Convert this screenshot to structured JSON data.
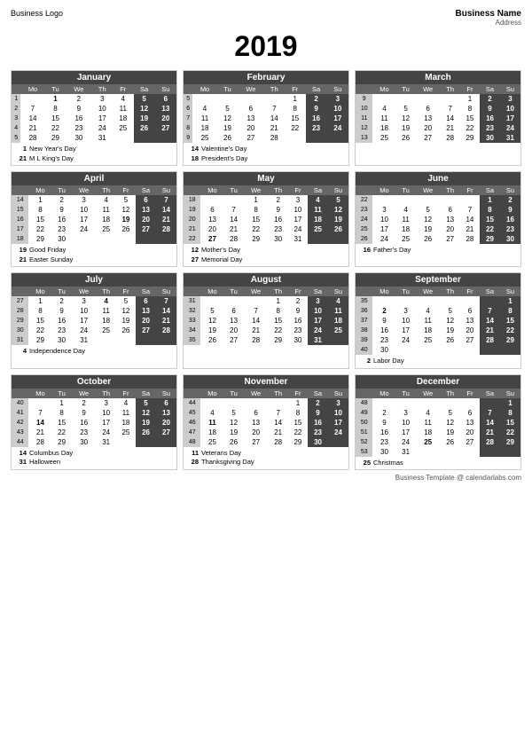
{
  "header": {
    "logo": "Business Logo",
    "name": "Business Name",
    "address": "Address"
  },
  "year": "2019",
  "footer": "Business Template @ calendarlabs.com",
  "months": [
    {
      "name": "January",
      "weeks": [
        [
          "",
          "Mo",
          "Tu",
          "We",
          "Th",
          "Fr",
          "Sa",
          "Su"
        ],
        [
          "1",
          "",
          "1",
          "2",
          "3",
          "4",
          "5",
          "6"
        ],
        [
          "2",
          "7",
          "8",
          "9",
          "10",
          "11",
          "12",
          "13"
        ],
        [
          "3",
          "14",
          "15",
          "16",
          "17",
          "18",
          "19",
          "20"
        ],
        [
          "4",
          "21",
          "22",
          "23",
          "24",
          "25",
          "26",
          "27"
        ],
        [
          "5",
          "28",
          "29",
          "30",
          "31",
          "",
          "",
          ""
        ]
      ],
      "holidays": [
        {
          "num": "1",
          "name": "New Year's Day"
        },
        {
          "num": "21",
          "name": "M L King's Day"
        }
      ]
    },
    {
      "name": "February",
      "weeks": [
        [
          "",
          "Mo",
          "Tu",
          "We",
          "Th",
          "Fr",
          "Sa",
          "Su"
        ],
        [
          "5",
          "",
          "",
          "",
          "",
          "1",
          "2",
          "3"
        ],
        [
          "6",
          "4",
          "5",
          "6",
          "7",
          "8",
          "9",
          "10"
        ],
        [
          "7",
          "11",
          "12",
          "13",
          "14",
          "15",
          "16",
          "17"
        ],
        [
          "8",
          "18",
          "19",
          "20",
          "21",
          "22",
          "23",
          "24"
        ],
        [
          "9",
          "25",
          "26",
          "27",
          "28",
          "",
          "",
          ""
        ]
      ],
      "holidays": [
        {
          "num": "14",
          "name": "Valentine's Day"
        },
        {
          "num": "18",
          "name": "President's Day"
        }
      ]
    },
    {
      "name": "March",
      "weeks": [
        [
          "",
          "Mo",
          "Tu",
          "We",
          "Th",
          "Fr",
          "Sa",
          "Su"
        ],
        [
          "9",
          "",
          "",
          "",
          "",
          "1",
          "2",
          "3"
        ],
        [
          "10",
          "4",
          "5",
          "6",
          "7",
          "8",
          "9",
          "10"
        ],
        [
          "11",
          "11",
          "12",
          "13",
          "14",
          "15",
          "16",
          "17"
        ],
        [
          "12",
          "18",
          "19",
          "20",
          "21",
          "22",
          "23",
          "24"
        ],
        [
          "13",
          "25",
          "26",
          "27",
          "28",
          "29",
          "30",
          "31"
        ]
      ],
      "holidays": []
    },
    {
      "name": "April",
      "weeks": [
        [
          "",
          "Mo",
          "Tu",
          "We",
          "Th",
          "Fr",
          "Sa",
          "Su"
        ],
        [
          "14",
          "1",
          "2",
          "3",
          "4",
          "5",
          "6",
          "7"
        ],
        [
          "15",
          "8",
          "9",
          "10",
          "11",
          "12",
          "13",
          "14"
        ],
        [
          "16",
          "15",
          "16",
          "17",
          "18",
          "19",
          "20",
          "21"
        ],
        [
          "17",
          "22",
          "23",
          "24",
          "25",
          "26",
          "27",
          "28"
        ],
        [
          "18",
          "29",
          "30",
          "",
          "",
          "",
          "",
          ""
        ]
      ],
      "holidays": [
        {
          "num": "19",
          "name": "Good Friday"
        },
        {
          "num": "21",
          "name": "Easter Sunday"
        }
      ]
    },
    {
      "name": "May",
      "weeks": [
        [
          "",
          "Mo",
          "Tu",
          "We",
          "Th",
          "Fr",
          "Sa",
          "Su"
        ],
        [
          "18",
          "",
          "",
          "1",
          "2",
          "3",
          "4",
          "5"
        ],
        [
          "19",
          "6",
          "7",
          "8",
          "9",
          "10",
          "11",
          "12"
        ],
        [
          "20",
          "13",
          "14",
          "15",
          "16",
          "17",
          "18",
          "19"
        ],
        [
          "21",
          "20",
          "21",
          "22",
          "23",
          "24",
          "25",
          "26"
        ],
        [
          "22",
          "27",
          "28",
          "29",
          "30",
          "31",
          "",
          ""
        ]
      ],
      "holidays": [
        {
          "num": "12",
          "name": "Mother's Day"
        },
        {
          "num": "27",
          "name": "Memorial Day"
        }
      ]
    },
    {
      "name": "June",
      "weeks": [
        [
          "",
          "Mo",
          "Tu",
          "We",
          "Th",
          "Fr",
          "Sa",
          "Su"
        ],
        [
          "22",
          "",
          "",
          "",
          "",
          "",
          "1",
          "2"
        ],
        [
          "23",
          "3",
          "4",
          "5",
          "6",
          "7",
          "8",
          "9"
        ],
        [
          "24",
          "10",
          "11",
          "12",
          "13",
          "14",
          "15",
          "16"
        ],
        [
          "25",
          "17",
          "18",
          "19",
          "20",
          "21",
          "22",
          "23"
        ],
        [
          "26",
          "24",
          "25",
          "26",
          "27",
          "28",
          "29",
          "30"
        ]
      ],
      "holidays": [
        {
          "num": "16",
          "name": "Father's Day"
        }
      ]
    },
    {
      "name": "July",
      "weeks": [
        [
          "",
          "Mo",
          "Tu",
          "We",
          "Th",
          "Fr",
          "Sa",
          "Su"
        ],
        [
          "27",
          "1",
          "2",
          "3",
          "4",
          "5",
          "6",
          "7"
        ],
        [
          "28",
          "8",
          "9",
          "10",
          "11",
          "12",
          "13",
          "14"
        ],
        [
          "29",
          "15",
          "16",
          "17",
          "18",
          "19",
          "20",
          "21"
        ],
        [
          "30",
          "22",
          "23",
          "24",
          "25",
          "26",
          "27",
          "28"
        ],
        [
          "31",
          "29",
          "30",
          "31",
          "",
          "",
          "",
          ""
        ]
      ],
      "holidays": [
        {
          "num": "4",
          "name": "Independence Day"
        }
      ]
    },
    {
      "name": "August",
      "weeks": [
        [
          "",
          "Mo",
          "Tu",
          "We",
          "Th",
          "Fr",
          "Sa",
          "Su"
        ],
        [
          "31",
          "",
          "",
          "",
          "1",
          "2",
          "3",
          "4"
        ],
        [
          "32",
          "5",
          "6",
          "7",
          "8",
          "9",
          "10",
          "11"
        ],
        [
          "33",
          "12",
          "13",
          "14",
          "15",
          "16",
          "17",
          "18"
        ],
        [
          "34",
          "19",
          "20",
          "21",
          "22",
          "23",
          "24",
          "25"
        ],
        [
          "35",
          "26",
          "27",
          "28",
          "29",
          "30",
          "31",
          ""
        ]
      ],
      "holidays": []
    },
    {
      "name": "September",
      "weeks": [
        [
          "",
          "Mo",
          "Tu",
          "We",
          "Th",
          "Fr",
          "Sa",
          "Su"
        ],
        [
          "35",
          "",
          "",
          "",
          "",
          "",
          "",
          "1"
        ],
        [
          "36",
          "2",
          "3",
          "4",
          "5",
          "6",
          "7",
          "8"
        ],
        [
          "37",
          "9",
          "10",
          "11",
          "12",
          "13",
          "14",
          "15"
        ],
        [
          "38",
          "16",
          "17",
          "18",
          "19",
          "20",
          "21",
          "22"
        ],
        [
          "39",
          "23",
          "24",
          "25",
          "26",
          "27",
          "28",
          "29"
        ],
        [
          "40",
          "30",
          "",
          "",
          "",
          "",
          "",
          ""
        ]
      ],
      "holidays": [
        {
          "num": "2",
          "name": "Labor Day"
        }
      ]
    },
    {
      "name": "October",
      "weeks": [
        [
          "",
          "Mo",
          "Tu",
          "We",
          "Th",
          "Fr",
          "Sa",
          "Su"
        ],
        [
          "40",
          "",
          "1",
          "2",
          "3",
          "4",
          "5",
          "6"
        ],
        [
          "41",
          "7",
          "8",
          "9",
          "10",
          "11",
          "12",
          "13"
        ],
        [
          "42",
          "14",
          "15",
          "16",
          "17",
          "18",
          "19",
          "20"
        ],
        [
          "43",
          "21",
          "22",
          "23",
          "24",
          "25",
          "26",
          "27"
        ],
        [
          "44",
          "28",
          "29",
          "30",
          "31",
          "",
          "",
          ""
        ]
      ],
      "holidays": [
        {
          "num": "14",
          "name": "Columbus Day"
        },
        {
          "num": "31",
          "name": "Halloween"
        }
      ]
    },
    {
      "name": "November",
      "weeks": [
        [
          "",
          "Mo",
          "Tu",
          "We",
          "Th",
          "Fr",
          "Sa",
          "Su"
        ],
        [
          "44",
          "",
          "",
          "",
          "",
          "1",
          "2",
          "3"
        ],
        [
          "45",
          "4",
          "5",
          "6",
          "7",
          "8",
          "9",
          "10"
        ],
        [
          "46",
          "11",
          "12",
          "13",
          "14",
          "15",
          "16",
          "17"
        ],
        [
          "47",
          "18",
          "19",
          "20",
          "21",
          "22",
          "23",
          "24"
        ],
        [
          "48",
          "25",
          "26",
          "27",
          "28",
          "29",
          "30",
          ""
        ]
      ],
      "holidays": [
        {
          "num": "11",
          "name": "Veterans Day"
        },
        {
          "num": "28",
          "name": "Thanksgiving Day"
        }
      ]
    },
    {
      "name": "December",
      "weeks": [
        [
          "",
          "Mo",
          "Tu",
          "We",
          "Th",
          "Fr",
          "Sa",
          "Su"
        ],
        [
          "48",
          "",
          "",
          "",
          "",
          "",
          "",
          "1"
        ],
        [
          "49",
          "2",
          "3",
          "4",
          "5",
          "6",
          "7",
          "8"
        ],
        [
          "50",
          "9",
          "10",
          "11",
          "12",
          "13",
          "14",
          "15"
        ],
        [
          "51",
          "16",
          "17",
          "18",
          "19",
          "20",
          "21",
          "22"
        ],
        [
          "52",
          "23",
          "24",
          "25",
          "26",
          "27",
          "28",
          "29"
        ],
        [
          "53",
          "30",
          "31",
          "",
          "",
          "",
          "",
          ""
        ]
      ],
      "holidays": [
        {
          "num": "25",
          "name": "Christmas"
        }
      ]
    }
  ]
}
